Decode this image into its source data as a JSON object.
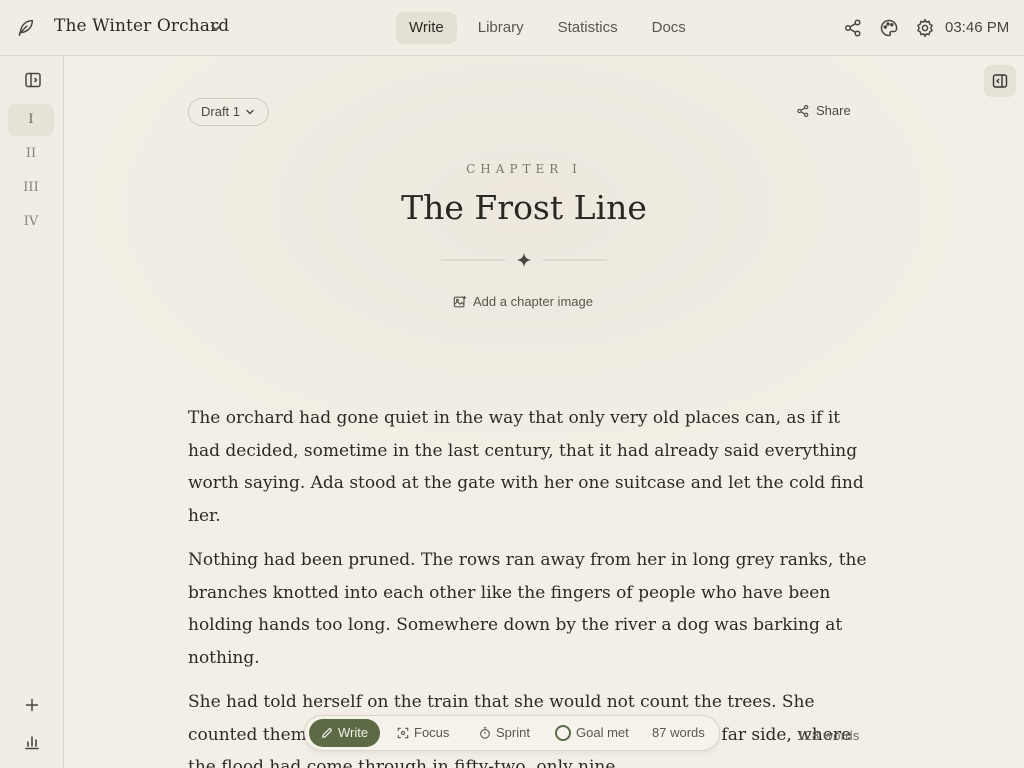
{
  "topbar": {
    "book_title": "The Winter Orchard",
    "tabs": [
      {
        "label": "Write",
        "active": true
      },
      {
        "label": "Library",
        "active": false
      },
      {
        "label": "Statistics",
        "active": false
      },
      {
        "label": "Docs",
        "active": false
      }
    ],
    "icons": [
      "feather-icon",
      "chevron-down-icon",
      "share-icon",
      "palette-icon",
      "gear-icon"
    ],
    "time": "03:46 PM"
  },
  "sidebar": {
    "chapters": [
      {
        "label": "I",
        "active": true
      },
      {
        "label": "II",
        "active": false
      },
      {
        "label": "III",
        "active": false
      },
      {
        "label": "IV",
        "active": false
      }
    ],
    "icons": [
      "sidebar-toggle-icon",
      "plus-icon",
      "bar-chart-icon"
    ]
  },
  "editor": {
    "draft_label": "Draft 1",
    "share_label": "Share",
    "chapter_label": "CHAPTER I",
    "chapter_title": "The Frost Line",
    "add_image_label": "Add a chapter image",
    "paragraphs": [
      "The orchard had gone quiet in the way that only very old places can, as if it had decided, sometime in the last century, that it had already said everything worth saying. Ada stood at the gate with her one suitcase and let the cold find her.",
      "Nothing had been pruned. The rows ran away from her in long grey ranks, the branches knotted into each other like the fingers of people who have been holding hands too long. Somewhere down by the river a dog was barking at nothing.",
      "She had told herself on the train that she would not count the trees. She counted them anyway. Forty-one on the near side, and on the far side, where the flood had come through in fifty-two, only nine."
    ]
  },
  "toolbar": {
    "write_label": "Write",
    "focus_label": "Focus",
    "sprint_label": "Sprint",
    "goal_label": "Goal met",
    "session_words": "87 words"
  },
  "word_count": "128 words",
  "colors": {
    "accent": "#5c6a45",
    "background": "#f3efe6",
    "text": "#2d2a24"
  }
}
